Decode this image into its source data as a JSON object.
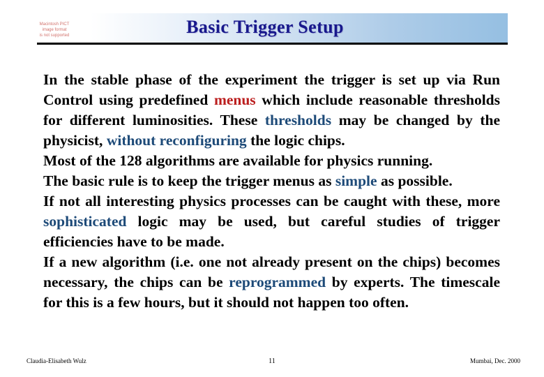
{
  "slide": {
    "title": "Basic Trigger Setup",
    "title_color": "#18188c",
    "page_number": "11"
  },
  "header": {
    "image_placeholder": {
      "line1": "Macintosh PICT",
      "line2": "image format",
      "line3": "is not supported",
      "color": "#d2736d"
    },
    "gradient_from": "#ffffff",
    "gradient_to": "#95bfe2",
    "rule_color": "#000000"
  },
  "highlight_colors": {
    "red": "#bb1e1e",
    "blue": "#1d4a78"
  },
  "body": {
    "p1_a": "In the stable phase of the experiment the trigger is set up via Run Control using predefined ",
    "p1_menus": "menus",
    "p1_b": " which include reasonable thresholds for different luminosities. These ",
    "p1_thresholds": "thresholds",
    "p1_c": " may be changed by the physicist, ",
    "p1_without": "without reconfiguring",
    "p1_d": " the logic chips.",
    "p2": "Most of the 128 algorithms are available for physics running.",
    "p3_a": "The basic rule is to keep the trigger menus as ",
    "p3_simple": "simple",
    "p3_b": " as possible.",
    "p4_a": "If not all interesting physics processes can be caught with these, more ",
    "p4_sophisticated": "sophisticated",
    "p4_b": " logic may be used, but careful studies of trigger efficiencies have to be made.",
    "p5_a": "If a new algorithm (i.e. one not already present on the chips) becomes necessary, the chips can be ",
    "p5_reprogrammed": "reprogrammed",
    "p5_b": " by experts. The timescale for this is a few hours, but it should not happen too often."
  },
  "footer": {
    "author": "Claudia-Elisabeth Wulz",
    "page": "11",
    "event": "Mumbai, Dec. 2000"
  }
}
